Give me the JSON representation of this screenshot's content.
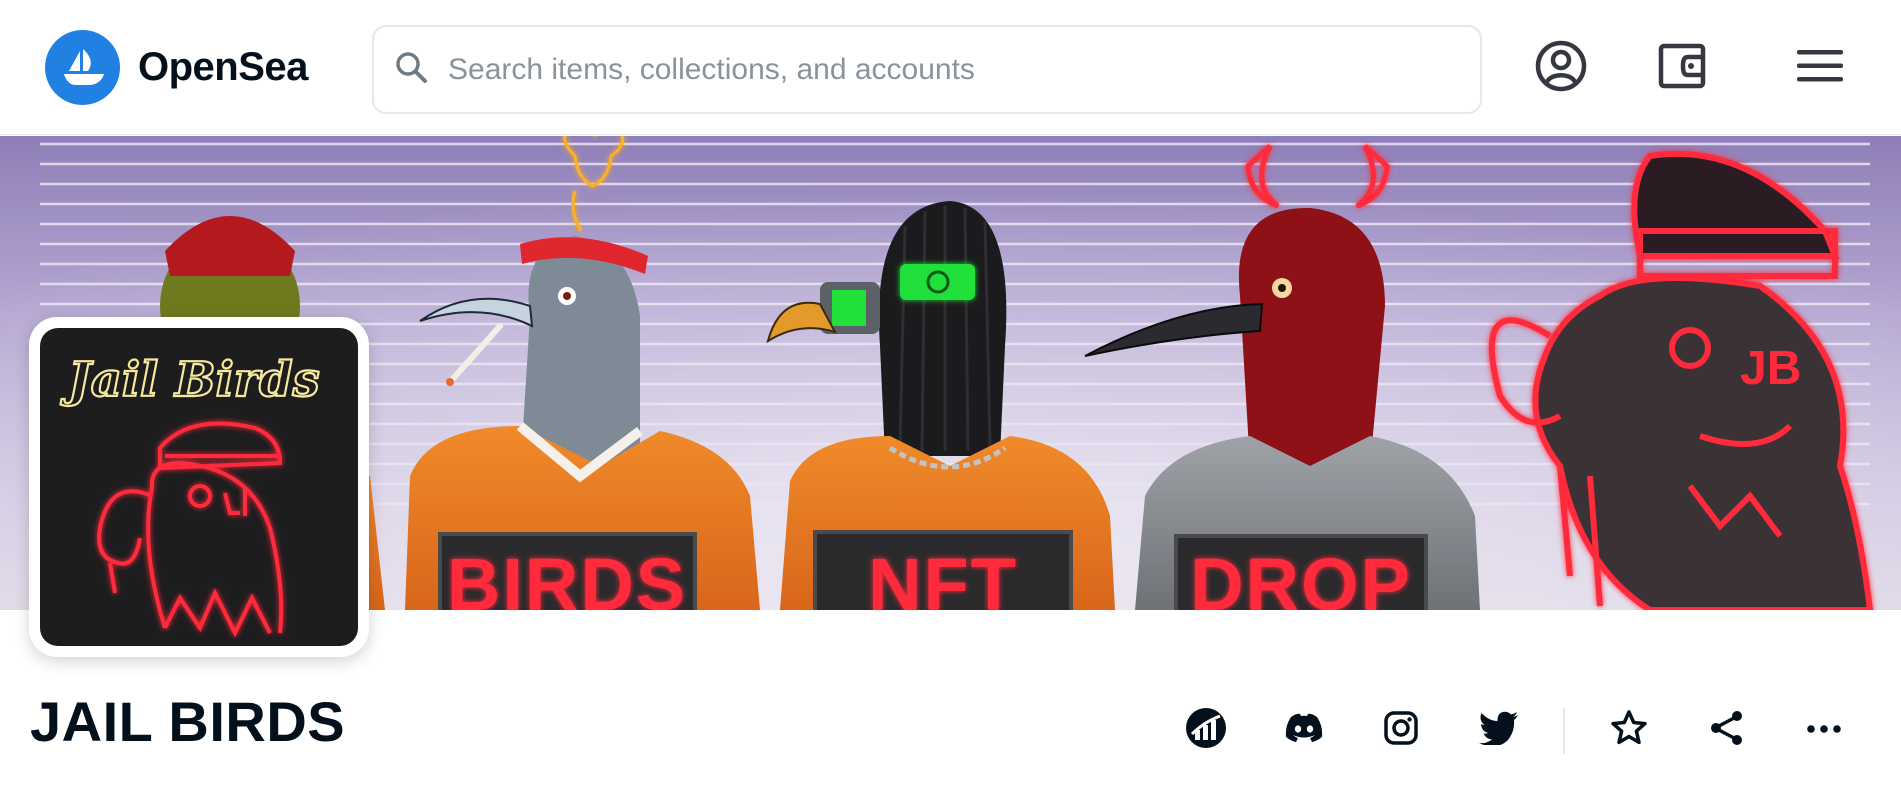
{
  "header": {
    "brand": "OpenSea",
    "search": {
      "placeholder": "Search items, collections, and accounts",
      "value": ""
    },
    "icons": [
      "opensea-logo-icon",
      "search-icon",
      "account-icon",
      "wallet-icon",
      "menu-icon"
    ]
  },
  "banner": {
    "signs": [
      "BIRDS",
      "NFT",
      "DROP"
    ],
    "neon_label": "JB"
  },
  "collection": {
    "avatar_script": "Jail Birds",
    "name": "JAIL BIRDS"
  },
  "actions": [
    "activity-icon",
    "discord-icon",
    "instagram-icon",
    "twitter-icon",
    "star-icon",
    "share-icon",
    "more-icon"
  ],
  "colors": {
    "brand": "#2081e2",
    "text": "#04111d",
    "neon": "#ff2a3a",
    "border": "#e5e8eb",
    "banner_bg": "#b7a9d3"
  }
}
